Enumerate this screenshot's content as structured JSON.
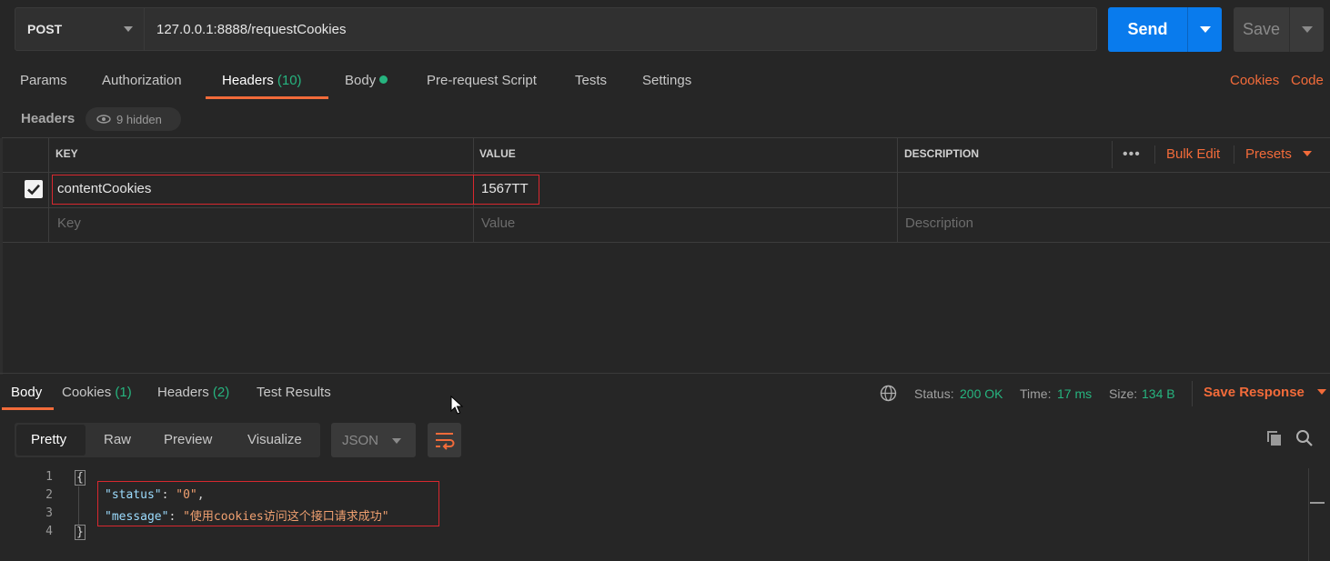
{
  "request": {
    "method": "POST",
    "url": "127.0.0.1:8888/requestCookies",
    "send_label": "Send",
    "save_label": "Save"
  },
  "tabs": [
    {
      "label": "Params"
    },
    {
      "label": "Authorization"
    },
    {
      "label": "Headers",
      "count": "(10)"
    },
    {
      "label": "Body"
    },
    {
      "label": "Pre-request Script"
    },
    {
      "label": "Tests"
    },
    {
      "label": "Settings"
    }
  ],
  "right_links": {
    "cookies": "Cookies",
    "code": "Code"
  },
  "headers_section": {
    "title": "Headers",
    "hidden": "9 hidden"
  },
  "table": {
    "columns": {
      "key": "KEY",
      "value": "VALUE",
      "description": "DESCRIPTION"
    },
    "bulk_edit": "Bulk Edit",
    "presets": "Presets",
    "rows": [
      {
        "key": "contentCookies",
        "value": "1567TT",
        "checked": true
      }
    ],
    "placeholders": {
      "key": "Key",
      "value": "Value",
      "description": "Description"
    }
  },
  "response": {
    "tabs": [
      {
        "label": "Body"
      },
      {
        "label": "Cookies",
        "count": "(1)"
      },
      {
        "label": "Headers",
        "count": "(2)"
      },
      {
        "label": "Test Results"
      }
    ],
    "status_label": "Status:",
    "status": "200 OK",
    "time_label": "Time:",
    "time": "17 ms",
    "size_label": "Size:",
    "size": "134 B",
    "save_response": "Save Response",
    "view_modes": [
      "Pretty",
      "Raw",
      "Preview",
      "Visualize"
    ],
    "format": "JSON",
    "line_numbers": [
      "1",
      "2",
      "3",
      "4"
    ],
    "code": {
      "open": "{",
      "status_key": "\"status\"",
      "status_val": "\"0\"",
      "message_key": "\"message\"",
      "message_val": "\"使用cookies访问这个接口请求成功\"",
      "close": "}"
    }
  },
  "colors": {
    "accent_orange": "#f26b3a",
    "send_blue": "#097bed",
    "success_green": "#26b47f"
  }
}
